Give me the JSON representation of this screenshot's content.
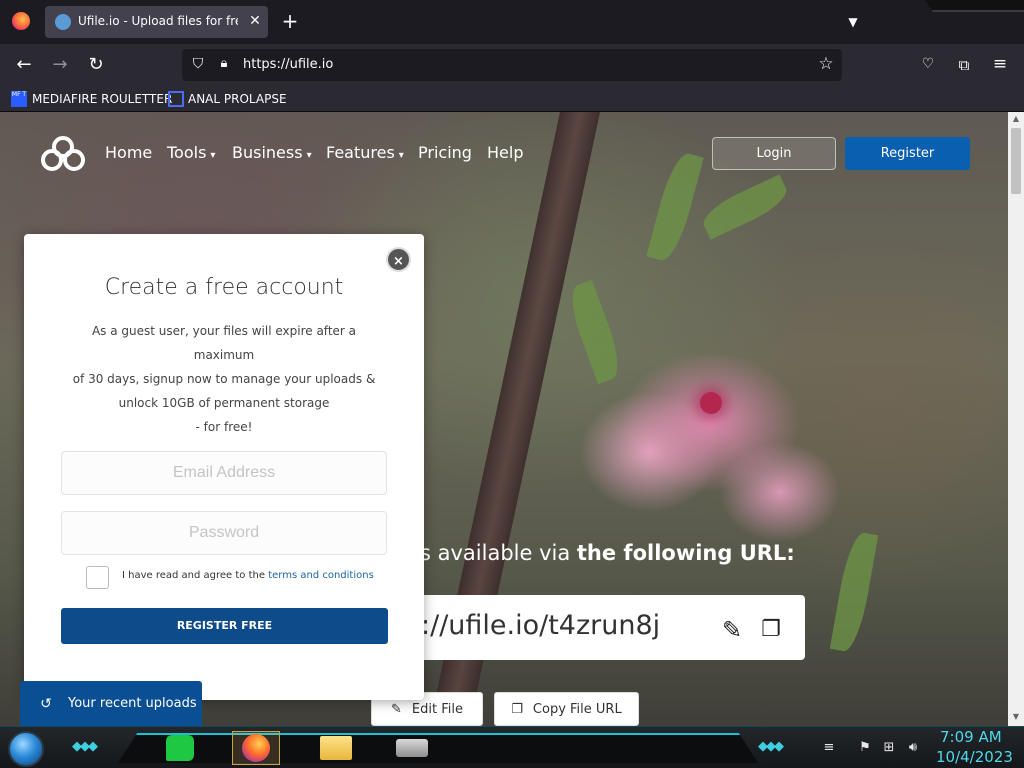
{
  "browser": {
    "tab": {
      "title": "Ufile.io - Upload files for free &",
      "close_glyph": "✕"
    },
    "new_tab_glyph": "+",
    "url": "https://ufile.io",
    "bookmarks": [
      {
        "label": "MEDIAFIRE ROULETTER",
        "icon_text": "MF T"
      },
      {
        "label": "ANAL PROLAPSE"
      }
    ],
    "icons": {
      "back": "back-arrow-icon",
      "forward": "forward-arrow-icon",
      "reload": "reload-icon",
      "shield": "tracking-shield-icon",
      "lock": "lock-icon",
      "star": "bookmark-star-icon",
      "pocket": "pocket-icon",
      "extensions": "extensions-icon",
      "menu": "hamburger-menu-icon"
    }
  },
  "site": {
    "nav": {
      "home": "Home",
      "tools": "Tools",
      "business": "Business",
      "features": "Features",
      "pricing": "Pricing",
      "help": "Help"
    },
    "login": "Login",
    "register": "Register",
    "accent_color": "#0b5fb0",
    "available_prefix": "s available via ",
    "available_bold": "the following URL:",
    "file_url": "://ufile.io/t4zrun8j",
    "edit_file": "Edit File",
    "copy_file_url": "Copy File URL",
    "recent_uploads": "Your recent uploads"
  },
  "modal": {
    "title": "Create a free account",
    "desc_line1": "As a guest user, your files will expire after a maximum",
    "desc_line2": "of 30 days, signup now to manage your uploads &",
    "desc_line3": "unlock 10GB of permanent storage",
    "desc_line4": "- for free!",
    "email_placeholder": "Email Address",
    "password_placeholder": "Password",
    "terms_prefix": "I have read and agree to the ",
    "terms_link": "terms and conditions",
    "register_free": "REGISTER FREE",
    "close_glyph": "×"
  },
  "taskbar": {
    "time": "7:09 AM",
    "date": "10/4/2023",
    "apps": [
      "notes",
      "firefox",
      "file-explorer",
      "drive"
    ]
  }
}
